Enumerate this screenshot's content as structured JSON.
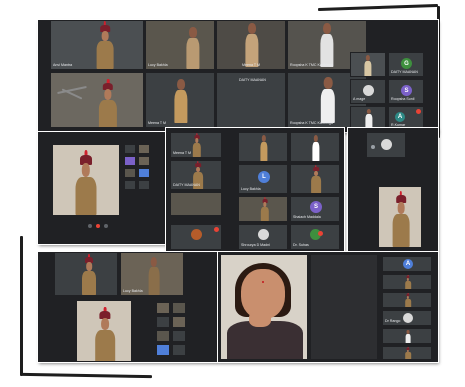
{
  "colors": {
    "meet_background": "#202124",
    "tile_background": "#3c4043",
    "avatar_blue": "#4f7fd9",
    "avatar_purple": "#7b61c9",
    "avatar_green": "#3e8f3e",
    "avatar_teal": "#2e8a86",
    "mic_muted": "#ea4335",
    "uniform_khaki": "#9c7a4b",
    "beret_maroon": "#7a1f2b"
  },
  "icons": [
    "mic-muted-icon",
    "speaker-icon",
    "hangup-icon",
    "ceiling-fan"
  ],
  "shot1": {
    "tiles": [
      {
        "label": "Anvi Mantra"
      },
      {
        "label": "Lucy Bakhla"
      },
      {
        "label": "Meena T M"
      },
      {
        "label": "Roopsha K TMC Karthinga"
      },
      {
        "label": ""
      },
      {
        "label": "Meena T M"
      },
      {
        "label": "DAITY MAANAN"
      },
      {
        "label": "Roopsha K TMC Karthinga"
      }
    ],
    "side": [
      {
        "label": "",
        "initial": ""
      },
      {
        "label": "DAITY MAANAN",
        "initial": "G"
      },
      {
        "label": "A mage",
        "initial": ""
      },
      {
        "label": "Roopsha Sunil",
        "initial": "S"
      },
      {
        "label": "",
        "initial": ""
      },
      {
        "label": "R.Kumar",
        "initial": "A"
      }
    ]
  },
  "shot3": {
    "tiles": [
      {
        "label": "Meena T M",
        "initial": ""
      },
      {
        "label": "DAITY MAANAN",
        "initial": ""
      },
      {
        "label": "",
        "initial": ""
      },
      {
        "label": "Lucy Bakhla",
        "initial": "L"
      },
      {
        "label": "",
        "initial": ""
      },
      {
        "label": "",
        "initial": ""
      },
      {
        "label": "Shaiach Maddala",
        "initial": "S"
      },
      {
        "label": "Shrourya D Madni",
        "initial": ""
      },
      {
        "label": "Dr. Suhas",
        "initial": ""
      }
    ]
  },
  "shot5": {
    "tiles": [
      {
        "label": ""
      },
      {
        "label": "Lucy Bakhla"
      }
    ]
  },
  "shot6": {
    "side": [
      {
        "label": "",
        "initial": "A"
      },
      {
        "label": "",
        "initial": ""
      },
      {
        "label": "",
        "initial": ""
      },
      {
        "label": "Dr Rango",
        "initial": ""
      },
      {
        "label": "",
        "initial": ""
      },
      {
        "label": "",
        "initial": ""
      }
    ]
  }
}
